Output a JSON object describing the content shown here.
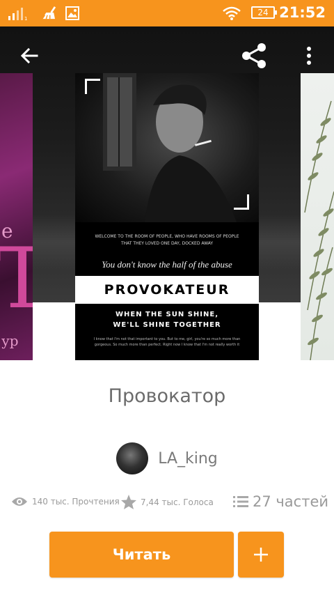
{
  "status_bar": {
    "time": "21:52",
    "battery": "24"
  },
  "toolbar": {
    "back_icon": "arrow-back-icon",
    "share_icon": "share-icon",
    "more_icon": "more-vertical-icon"
  },
  "cover": {
    "welcome_line_1": "WELCOME TO THE ROOM OF PEOPLE, WHO HAVE ROOMS OF PEOPLE",
    "welcome_line_2": "THAT THEY LOVED ONE DAY, DOCKED AWAY",
    "quote": "You don't know the half of the abuse",
    "title": "PROVOKATEUR",
    "tagline_1": "WHEN THE SUN SHINE,",
    "tagline_2": "WE'LL SHINE TOGETHER",
    "small_text": "I know that I'm not that important to you. But to me, girl, you're so much more than gorgeous. So much more than perfect. Right now I know that I'm not really worth it"
  },
  "left_cover": {
    "glyph_e": "e",
    "glyph_t": "T",
    "glyph_yp": "ур"
  },
  "story": {
    "title": "Провокатор",
    "author": "LA_king",
    "reads": "140 тыс. Прочтения",
    "votes": "7,44 тыс. Голоса",
    "parts": "27 частей"
  },
  "actions": {
    "read_label": "Читать",
    "add_label": "+"
  },
  "colors": {
    "accent": "#f7941d",
    "text_gray": "#6b6b6b",
    "meta_gray": "#9a9a9a"
  }
}
